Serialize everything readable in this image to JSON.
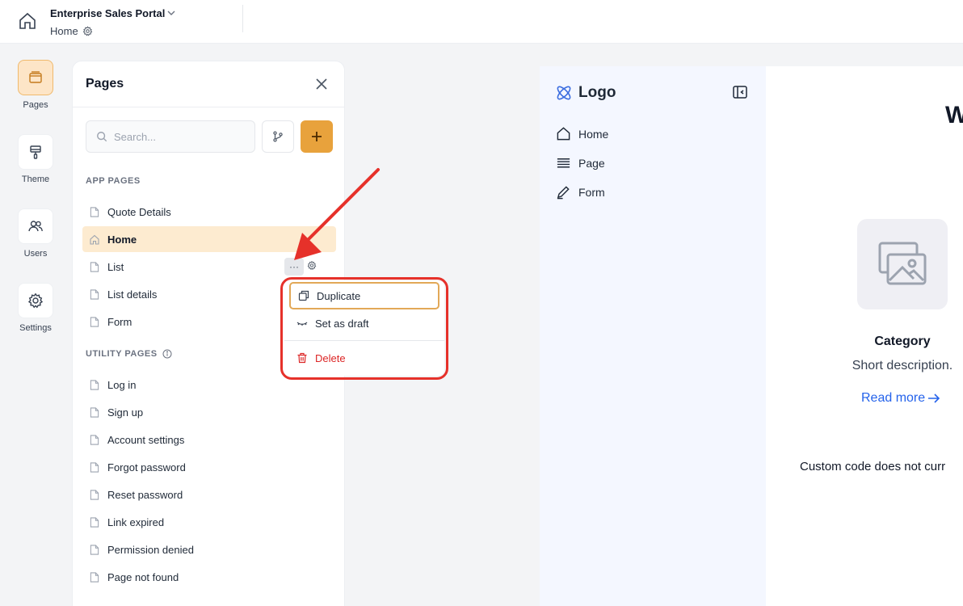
{
  "topbar": {
    "app_name": "Enterprise Sales Portal",
    "breadcrumb": "Home"
  },
  "rail": {
    "items": [
      {
        "label": "Pages",
        "icon": "pages-icon",
        "active": true
      },
      {
        "label": "Theme",
        "icon": "paint-roller-icon"
      },
      {
        "label": "Users",
        "icon": "users-icon"
      },
      {
        "label": "Settings",
        "icon": "gear-icon"
      }
    ]
  },
  "panel": {
    "title": "Pages",
    "search_placeholder": "Search...",
    "app_pages_label": "APP PAGES",
    "app_pages": [
      "Quote Details",
      "Home",
      "List",
      "List details",
      "Form"
    ],
    "active_page": "Home",
    "utility_pages_label": "UTILITY PAGES",
    "utility_pages": [
      "Log in",
      "Sign up",
      "Account settings",
      "Forgot password",
      "Reset password",
      "Link expired",
      "Permission denied",
      "Page not found"
    ]
  },
  "context_menu": {
    "more_label": "···",
    "items": [
      {
        "label": "Duplicate",
        "icon": "copy-icon"
      },
      {
        "label": "Set as draft",
        "icon": "closed-eye-icon"
      },
      {
        "label": "Delete",
        "icon": "trash-icon",
        "danger": true
      }
    ]
  },
  "preview": {
    "logo": "Logo",
    "nav": [
      "Home",
      "Page",
      "Form"
    ],
    "heading_fragment": "W",
    "category": "Category",
    "description": "Short description.",
    "read_more": "Read more",
    "custom_code_note": "Custom code does not curr"
  },
  "colors": {
    "accent": "#e8a23c",
    "active_row": "#fdebd0",
    "danger": "#dc2626",
    "link": "#2563eb",
    "annotation": "#e6312a"
  }
}
